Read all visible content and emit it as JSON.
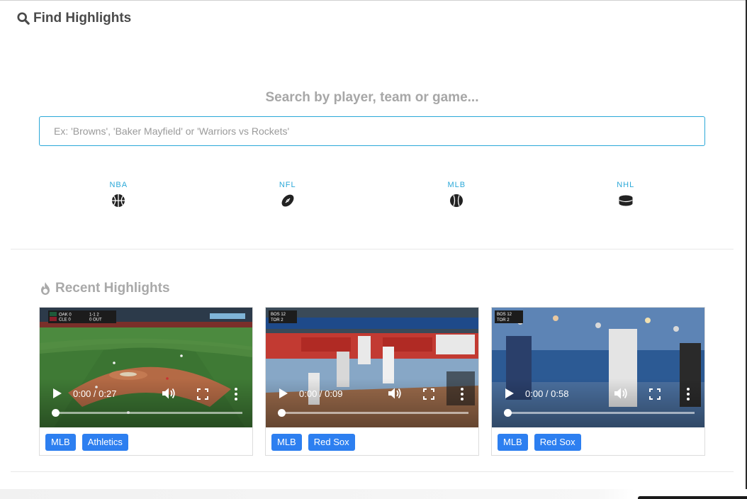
{
  "header": {
    "title": "Find Highlights",
    "icon": "search-icon"
  },
  "search": {
    "prompt": "Search by player, team or game...",
    "placeholder": "Ex: 'Browns', 'Baker Mayfield' or 'Warriors vs Rockets'",
    "value": ""
  },
  "leagues": [
    {
      "label": "NBA",
      "icon": "basketball-icon"
    },
    {
      "label": "NFL",
      "icon": "football-icon"
    },
    {
      "label": "MLB",
      "icon": "baseball-icon"
    },
    {
      "label": "NHL",
      "icon": "hockey-puck-icon"
    }
  ],
  "recent": {
    "title": "Recent Highlights",
    "icon": "fire-icon",
    "videos": [
      {
        "time": "0:00 / 0:27",
        "progress": 0,
        "tags": [
          "MLB",
          "Athletics"
        ]
      },
      {
        "time": "0:00 / 0:09",
        "progress": 0,
        "tags": [
          "MLB",
          "Red Sox"
        ]
      },
      {
        "time": "0:00 / 0:58",
        "progress": 0,
        "tags": [
          "MLB",
          "Red Sox"
        ]
      }
    ]
  },
  "colors": {
    "accent": "#2ba8d8",
    "tag": "#2d7ff0",
    "heading": "#4a4a4a",
    "muted": "#a7a7a7"
  }
}
